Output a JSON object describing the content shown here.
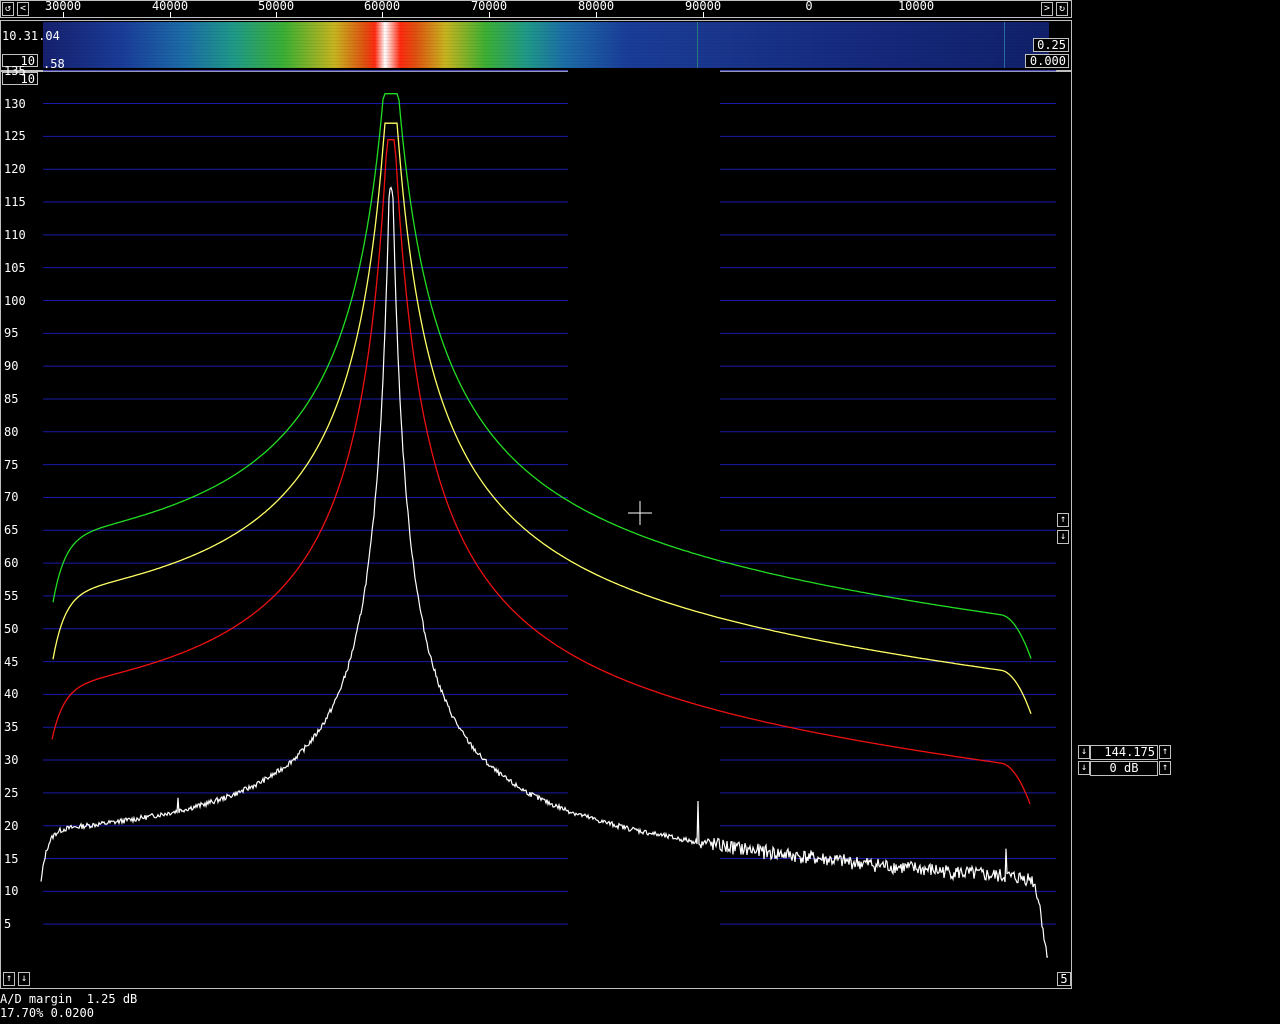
{
  "freq_axis": {
    "left_labels": [
      "30000",
      "40000",
      "50000",
      "60000",
      "70000",
      "80000",
      "90000"
    ],
    "right_labels": [
      "0",
      "10000"
    ],
    "scroll_left_icon": "arrow-left-icon",
    "scroll_right_icon": "arrow-right-icon"
  },
  "waterfall": {
    "time": "10.31.04",
    "gain_value": "10",
    "left_fragment": ".58",
    "right_top": "0.25",
    "right_bottom": "0.000"
  },
  "spectrum": {
    "avg_count": "10",
    "y_ticks": [
      "135",
      "130",
      "125",
      "120",
      "115",
      "110",
      "105",
      "100",
      "95",
      "90",
      "85",
      "80",
      "75",
      "70",
      "65",
      "60",
      "55",
      "50",
      "45",
      "40",
      "35",
      "30",
      "25",
      "20",
      "15",
      "10",
      "5"
    ],
    "bottom_right_value": "5",
    "colors": {
      "grid": "#1a1aa8",
      "green": "#22dd22",
      "yellow": "#ffff66",
      "red": "#ee1111",
      "white": "#ffffff"
    }
  },
  "side_controls": {
    "frequency": "144.175",
    "gain": "0 dB"
  },
  "status": {
    "ad_margin": "A/D margin  1.25 dB",
    "load": "17.70% 0.0200"
  }
}
